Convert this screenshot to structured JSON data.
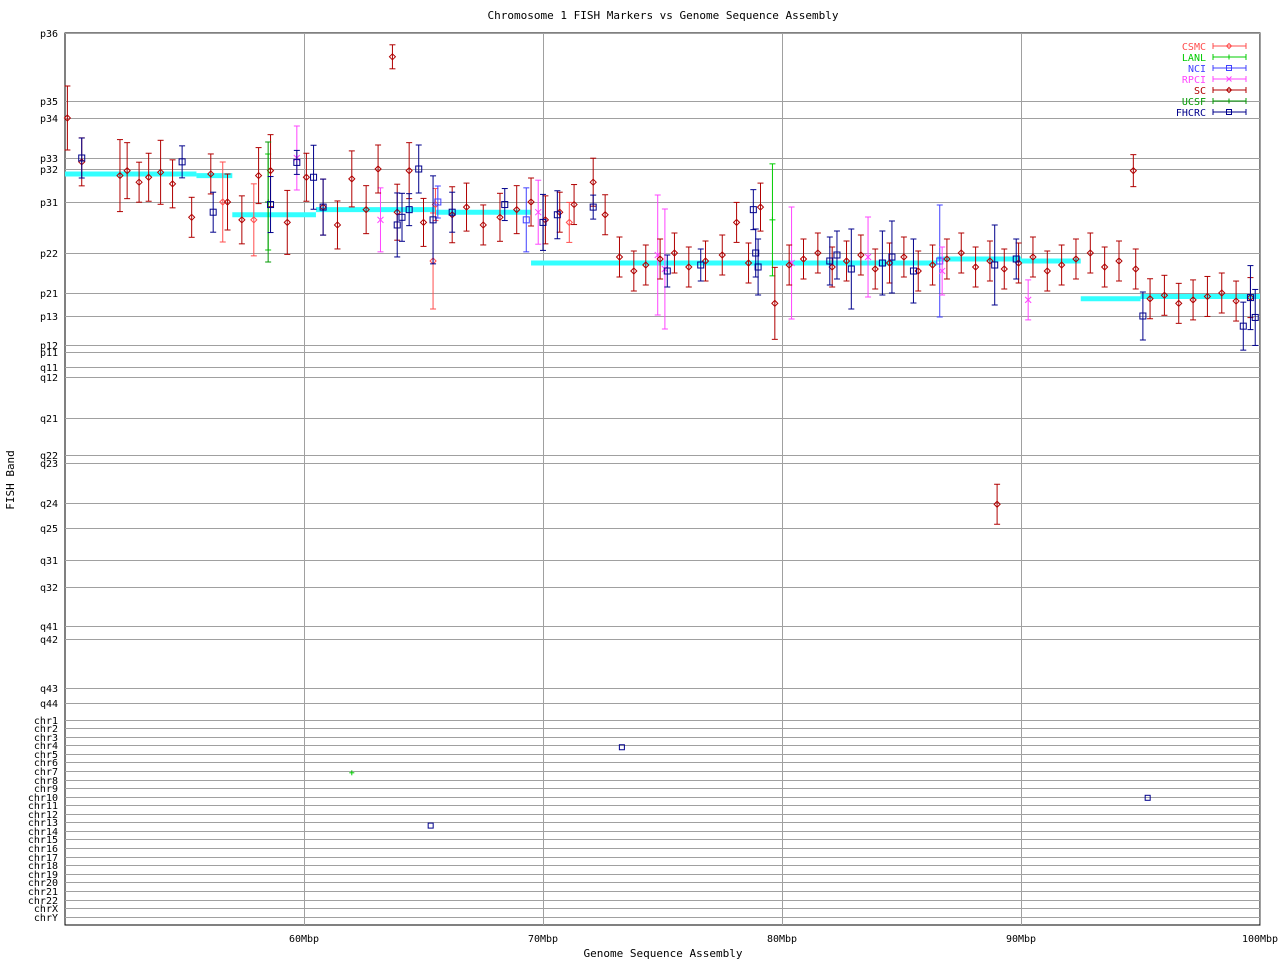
{
  "chart_data": {
    "type": "scatter",
    "title": "Chromosome 1 FISH Markers vs Genome Sequence Assembly",
    "xlabel": "Genome Sequence Assembly",
    "ylabel": "FISH Band",
    "xlim": [
      50,
      100
    ],
    "x_unit": "Mbp",
    "x_ticks": [
      60,
      70,
      80,
      90,
      100
    ],
    "x_tick_labels": [
      "60Mbp",
      "70Mbp",
      "80Mbp",
      "90Mbp",
      "100Mbp"
    ],
    "grid": true,
    "legend_position": "top-right",
    "y_bands": [
      "p36",
      "p35",
      "p34",
      "p33",
      "p32",
      "p31",
      "p22",
      "p21",
      "p13",
      "p12",
      "p11",
      "q11",
      "q12",
      "q21",
      "q22",
      "q23",
      "q24",
      "q25",
      "q31",
      "q32",
      "q41",
      "q42",
      "q43",
      "q44",
      "chr1",
      "chr2",
      "chr3",
      "chr4",
      "chr5",
      "chr6",
      "chr7",
      "chr8",
      "chr9",
      "chr10",
      "chr11",
      "chr12",
      "chr13",
      "chr14",
      "chr15",
      "chr16",
      "chr17",
      "chr18",
      "chr19",
      "chr20",
      "chr21",
      "chr22",
      "chrX",
      "chrY"
    ],
    "series": [
      {
        "name": "CSMC",
        "color": "#ff4d4d",
        "marker": "diamond",
        "points": [
          [
            56.6,
            "p31",
            1
          ],
          [
            57.9,
            "p31",
            0.9
          ],
          [
            65.4,
            "p22",
            1.2
          ],
          [
            65.5,
            "p31",
            0.4
          ],
          [
            71.1,
            "p31",
            0.5
          ]
        ]
      },
      {
        "name": "LANL",
        "color": "#00cc00",
        "marker": "plus",
        "points": [
          [
            58.5,
            "p31",
            1.2
          ],
          [
            79.6,
            "p31",
            1.4
          ],
          [
            62.0,
            "chr7",
            0
          ]
        ]
      },
      {
        "name": "NCI",
        "color": "#4040ff",
        "marker": "square",
        "points": [
          [
            65.6,
            "p31",
            0.4
          ],
          [
            69.3,
            "p31",
            0.8
          ],
          [
            86.6,
            "p22",
            1.4
          ]
        ]
      },
      {
        "name": "RPCI",
        "color": "#ff44ff",
        "marker": "cross",
        "points": [
          [
            59.7,
            "p33",
            0.8
          ],
          [
            63.2,
            "p31",
            0.8
          ],
          [
            69.8,
            "p31",
            0.8
          ],
          [
            74.8,
            "p22",
            1.5
          ],
          [
            75.1,
            "p22",
            1.5
          ],
          [
            80.4,
            "p22",
            1.4
          ],
          [
            83.6,
            "p22",
            1.0
          ],
          [
            86.7,
            "p22",
            0.6
          ],
          [
            90.3,
            "p21",
            0.5
          ]
        ]
      },
      {
        "name": "SC",
        "color": "#b00000",
        "marker": "diamond",
        "points": [
          [
            50.1,
            "p34",
            0.8
          ],
          [
            50.7,
            "p33",
            0.6
          ],
          [
            52.3,
            "p32",
            0.9
          ],
          [
            52.6,
            "p32",
            0.7
          ],
          [
            53.1,
            "p32",
            0.5
          ],
          [
            53.5,
            "p32",
            0.6
          ],
          [
            54.0,
            "p32",
            0.8
          ],
          [
            54.5,
            "p32",
            0.6
          ],
          [
            55.3,
            "p31",
            0.5
          ],
          [
            56.1,
            "p32",
            0.5
          ],
          [
            56.8,
            "p31",
            0.7
          ],
          [
            57.4,
            "p31",
            0.6
          ],
          [
            58.1,
            "p32",
            0.7
          ],
          [
            58.6,
            "p32",
            0.9
          ],
          [
            59.3,
            "p31",
            0.8
          ],
          [
            60.1,
            "p32",
            0.6
          ],
          [
            60.8,
            "p31",
            0.7
          ],
          [
            61.4,
            "p31",
            0.6
          ],
          [
            62.0,
            "p32",
            0.7
          ],
          [
            62.6,
            "p31",
            0.6
          ],
          [
            63.1,
            "p32",
            0.6
          ],
          [
            63.7,
            "p36",
            0.3
          ],
          [
            63.9,
            "p31",
            0.7
          ],
          [
            64.4,
            "p32",
            0.7
          ],
          [
            65.0,
            "p31",
            0.6
          ],
          [
            66.2,
            "p31",
            0.7
          ],
          [
            66.8,
            "p31",
            0.6
          ],
          [
            67.5,
            "p31",
            0.5
          ],
          [
            68.2,
            "p31",
            0.6
          ],
          [
            68.9,
            "p31",
            0.6
          ],
          [
            69.5,
            "p31",
            0.6
          ],
          [
            70.1,
            "p31",
            0.6
          ],
          [
            70.7,
            "p31",
            0.5
          ],
          [
            71.3,
            "p31",
            0.5
          ],
          [
            72.1,
            "p32",
            0.6
          ],
          [
            72.6,
            "p31",
            0.5
          ],
          [
            73.2,
            "p22",
            0.5
          ],
          [
            73.8,
            "p22",
            0.5
          ],
          [
            74.3,
            "p22",
            0.5
          ],
          [
            74.9,
            "p22",
            0.5
          ],
          [
            75.5,
            "p22",
            0.5
          ],
          [
            76.1,
            "p22",
            0.5
          ],
          [
            76.8,
            "p22",
            0.5
          ],
          [
            77.5,
            "p22",
            0.5
          ],
          [
            78.1,
            "p31",
            0.5
          ],
          [
            78.6,
            "p22",
            0.5
          ],
          [
            79.1,
            "p31",
            0.6
          ],
          [
            79.7,
            "p21",
            0.9
          ],
          [
            80.3,
            "p22",
            0.5
          ],
          [
            80.9,
            "p22",
            0.5
          ],
          [
            81.5,
            "p22",
            0.5
          ],
          [
            82.1,
            "p22",
            0.5
          ],
          [
            82.7,
            "p22",
            0.5
          ],
          [
            83.3,
            "p22",
            0.5
          ],
          [
            83.9,
            "p22",
            0.5
          ],
          [
            84.5,
            "p22",
            0.5
          ],
          [
            85.1,
            "p22",
            0.5
          ],
          [
            85.7,
            "p22",
            0.5
          ],
          [
            86.3,
            "p22",
            0.5
          ],
          [
            86.9,
            "p22",
            0.5
          ],
          [
            87.5,
            "p22",
            0.5
          ],
          [
            88.1,
            "p22",
            0.5
          ],
          [
            88.7,
            "p22",
            0.5
          ],
          [
            89.0,
            "q24",
            0.5
          ],
          [
            89.3,
            "p22",
            0.5
          ],
          [
            89.9,
            "p22",
            0.5
          ],
          [
            90.5,
            "p22",
            0.5
          ],
          [
            91.1,
            "p22",
            0.5
          ],
          [
            91.7,
            "p22",
            0.5
          ],
          [
            92.3,
            "p22",
            0.5
          ],
          [
            92.9,
            "p22",
            0.5
          ],
          [
            93.5,
            "p22",
            0.5
          ],
          [
            94.1,
            "p22",
            0.5
          ],
          [
            94.7,
            "p32",
            0.4
          ],
          [
            94.8,
            "p22",
            0.5
          ],
          [
            95.4,
            "p21",
            0.5
          ],
          [
            96.0,
            "p21",
            0.5
          ],
          [
            96.6,
            "p21",
            0.5
          ],
          [
            97.2,
            "p21",
            0.5
          ],
          [
            97.8,
            "p21",
            0.5
          ],
          [
            98.4,
            "p21",
            0.5
          ],
          [
            99.0,
            "p21",
            0.5
          ],
          [
            99.6,
            "p21",
            0.5
          ]
        ]
      },
      {
        "name": "UCSF",
        "color": "#009900",
        "marker": "plus",
        "points": [
          [
            58.5,
            "p31",
            1.5
          ]
        ]
      },
      {
        "name": "FHCRC",
        "color": "#00008b",
        "marker": "square",
        "points": [
          [
            50.7,
            "p33",
            0.5
          ],
          [
            54.9,
            "p33",
            0.4
          ],
          [
            56.2,
            "p31",
            0.5
          ],
          [
            58.6,
            "p31",
            0.7
          ],
          [
            59.7,
            "p33",
            0.3
          ],
          [
            60.4,
            "p32",
            0.8
          ],
          [
            60.8,
            "p31",
            0.7
          ],
          [
            63.9,
            "p31",
            0.8
          ],
          [
            64.1,
            "p31",
            0.6
          ],
          [
            64.4,
            "p31",
            0.4
          ],
          [
            64.8,
            "p32",
            0.6
          ],
          [
            65.4,
            "p31",
            1.1
          ],
          [
            66.2,
            "p31",
            0.5
          ],
          [
            68.4,
            "p31",
            0.4
          ],
          [
            70.0,
            "p31",
            0.7
          ],
          [
            70.6,
            "p31",
            0.6
          ],
          [
            72.1,
            "p31",
            0.3
          ],
          [
            75.2,
            "p22",
            0.4
          ],
          [
            76.6,
            "p22",
            0.4
          ],
          [
            78.8,
            "p31",
            0.5
          ],
          [
            78.9,
            "p22",
            0.6
          ],
          [
            79.0,
            "p22",
            0.7
          ],
          [
            82.0,
            "p22",
            0.6
          ],
          [
            82.3,
            "p22",
            0.6
          ],
          [
            82.9,
            "p22",
            1.0
          ],
          [
            84.2,
            "p22",
            0.8
          ],
          [
            84.6,
            "p22",
            0.9
          ],
          [
            85.5,
            "p22",
            0.8
          ],
          [
            88.9,
            "p22",
            1.0
          ],
          [
            89.8,
            "p22",
            0.5
          ],
          [
            95.1,
            "p13",
            0.6
          ],
          [
            99.3,
            "p13",
            0.6
          ],
          [
            99.6,
            "p21",
            0.8
          ],
          [
            99.8,
            "p13",
            0.7
          ],
          [
            65.3,
            "chr13",
            0
          ],
          [
            73.3,
            "chr4",
            0
          ],
          [
            95.3,
            "chr10",
            0
          ]
        ]
      }
    ],
    "assembly_trend": {
      "color": "#33ffff",
      "segments": [
        [
          50,
          "p32",
          55.5
        ],
        [
          55.5,
          "p32",
          57.0
        ],
        [
          57.0,
          "p31",
          60.5
        ],
        [
          60.5,
          "p31",
          65.5
        ],
        [
          65.5,
          "p31",
          69.5
        ],
        [
          69.5,
          "p22",
          86.5
        ],
        [
          86.5,
          "p22",
          90.0
        ],
        [
          90.0,
          "p22",
          92.5
        ],
        [
          92.5,
          "p21",
          95.0
        ],
        [
          95.0,
          "p21",
          100
        ]
      ]
    }
  }
}
